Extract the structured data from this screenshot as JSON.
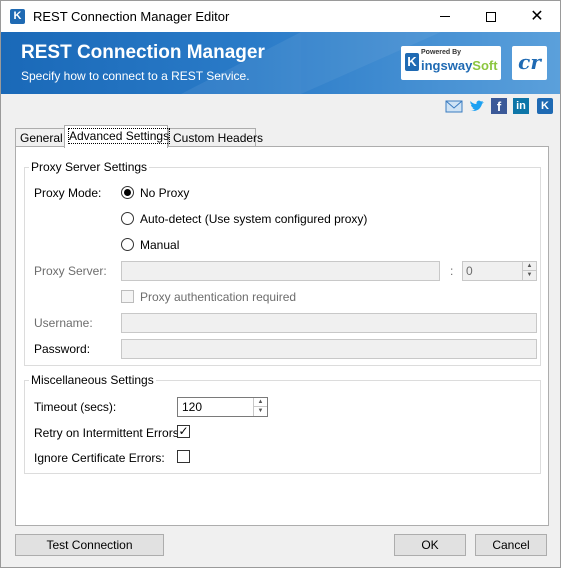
{
  "window": {
    "title": "REST Connection Manager Editor",
    "icon_letter": "K",
    "controls": {
      "minimize": "minimize-icon",
      "maximize": "maximize-icon",
      "close_glyph": "✕"
    }
  },
  "banner": {
    "title": "REST Connection Manager",
    "subtitle": "Specify how to connect to a REST Service.",
    "powered_by": "Powered By",
    "brand_k": "K",
    "brand_main": "ingsway",
    "brand_soft": "Soft",
    "cr_logo": "cr",
    "colors": {
      "start": "#1a69b8",
      "end": "#5ba0db"
    }
  },
  "social": {
    "fb": "f",
    "in": "in",
    "k": "K"
  },
  "tabs": [
    {
      "label": "General"
    },
    {
      "label": "Advanced Settings",
      "active": true
    },
    {
      "label": "Custom Headers"
    }
  ],
  "proxy": {
    "legend": "Proxy Server Settings",
    "mode_label": "Proxy Mode:",
    "options": [
      {
        "label": "No Proxy",
        "checked": true
      },
      {
        "label": "Auto-detect (Use system configured proxy)",
        "checked": false
      },
      {
        "label": "Manual",
        "checked": false
      }
    ],
    "server_label": "Proxy Server:",
    "server_value": "",
    "port_separator": ":",
    "port_value": "0",
    "auth_label": "Proxy authentication required",
    "username_label": "Username:",
    "password_label": "Password:"
  },
  "misc": {
    "legend": "Miscellaneous Settings",
    "timeout_label": "Timeout (secs):",
    "timeout_value": "120",
    "retry_label": "Retry on Intermittent Errors:",
    "retry_checked": true,
    "ignore_cert_label": "Ignore Certificate Errors:",
    "ignore_cert_checked": false,
    "check_glyph": "✓"
  },
  "buttons": {
    "test": "Test Connection",
    "ok": "OK",
    "cancel": "Cancel"
  }
}
